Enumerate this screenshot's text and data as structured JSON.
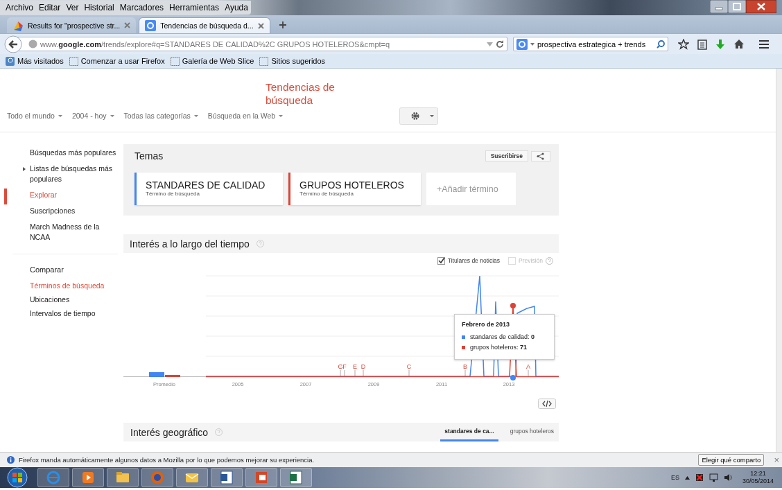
{
  "menu_bar": [
    "Archivo",
    "Editar",
    "Ver",
    "Historial",
    "Marcadores",
    "Herramientas",
    "Ayuda"
  ],
  "tabs": [
    {
      "title": "Results for \"prospective str...",
      "selected": false
    },
    {
      "title": "Tendencias de búsqueda d...",
      "selected": true
    }
  ],
  "address_bar": {
    "url": "www.**google.com**/trends/explore#q=STANDARES DE CALIDAD%2C GRUPOS HOTELEROS&cmpt=q"
  },
  "search_bar": {
    "value": "prospectiva estrategica + trends"
  },
  "bookmarks": [
    "Más visitados",
    "Comenzar a usar Firefox",
    "Galería de Web Slice",
    "Sitios sugeridos"
  ],
  "page": {
    "title": "Tendencias de búsqueda",
    "filters": [
      "Todo el mundo",
      "2004 - hoy",
      "Todas las categorías",
      "Búsqueda en la Web"
    ],
    "sidebar": {
      "items": [
        {
          "label": "Búsquedas más populares",
          "kind": "link",
          "selected": false
        },
        {
          "label": "Listas de búsquedas más populares",
          "kind": "expandable",
          "selected": false
        },
        {
          "label": "Explorar",
          "kind": "link",
          "selected": true
        },
        {
          "label": "Suscripciones",
          "kind": "link",
          "selected": false
        },
        {
          "label": "March Madness de la NCAA",
          "kind": "link",
          "selected": false
        }
      ],
      "compare_heading": "Comparar",
      "compare_items": [
        {
          "label": "Términos de búsqueda",
          "selected": true
        },
        {
          "label": "Ubicaciones",
          "selected": false
        },
        {
          "label": "Intervalos de tiempo",
          "selected": false
        }
      ]
    },
    "topics": {
      "title": "Temas",
      "subscribe": "Suscribirse",
      "terms": [
        {
          "name": "STANDARES DE CALIDAD",
          "subtitle": "Término de búsqueda",
          "color": "#4285f4"
        },
        {
          "name": "GRUPOS HOTELEROS",
          "subtitle": "Término de búsqueda",
          "color": "#db4437"
        }
      ],
      "add": "+Añadir término"
    },
    "interest_over_time": {
      "title": "Interés a lo largo del tiempo",
      "options": [
        {
          "label": "Titulares de noticias",
          "checked": true,
          "disabled": false
        },
        {
          "label": "Previsión",
          "checked": false,
          "disabled": true
        }
      ],
      "average_label": "Promedio",
      "years": [
        "2005",
        "2007",
        "2009",
        "2011",
        "2013"
      ],
      "event_markers": [
        "G",
        "F",
        "E",
        "D",
        "C",
        "B",
        "A"
      ],
      "tooltip": {
        "title": "Febrero de 2013",
        "rows": [
          {
            "text": "standares de calidad: **0**",
            "color": "#4285f4"
          },
          {
            "text": "grupos hoteleros: **71**",
            "color": "#db4437"
          }
        ]
      }
    },
    "geo": {
      "title": "Interés geográfico",
      "tabs": [
        {
          "label": "standares de ca...",
          "selected": true
        },
        {
          "label": "grupos hoteleros",
          "selected": false
        }
      ]
    }
  },
  "notification_bar": {
    "text": "Firefox manda automáticamente algunos datos a Mozilla por lo que podemos mejorar su experiencia.",
    "button": "Elegir qué comparto",
    "close": "×"
  },
  "taskbar": {
    "language": "ES",
    "time": "12:21",
    "date": "30/05/2014"
  }
}
